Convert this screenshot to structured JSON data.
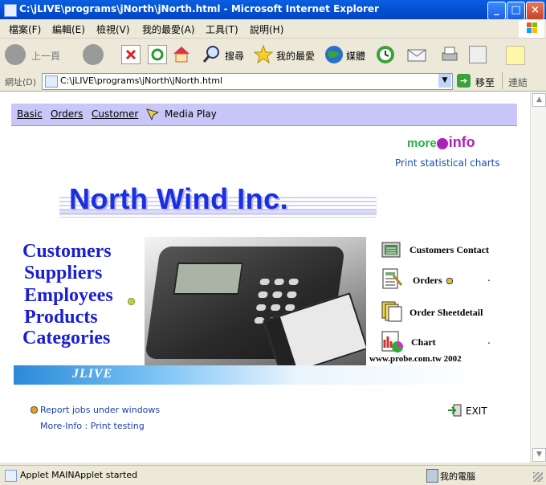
{
  "window": {
    "title": "C:\\jLIVE\\programs\\jNorth\\jNorth.html - Microsoft Internet Explorer"
  },
  "menu": [
    "檔案(F)",
    "編輯(E)",
    "檢視(V)",
    "我的最愛(A)",
    "工具(T)",
    "說明(H)"
  ],
  "toolbar": {
    "back": "上一頁",
    "search": "搜尋",
    "favorites": "我的最愛",
    "media": "媒體"
  },
  "address": {
    "label": "網址(D)",
    "url": "C:\\jLIVE\\programs\\jNorth\\jNorth.html",
    "go": "移至",
    "links": "連結"
  },
  "nav": {
    "basic": "Basic",
    "orders": "Orders",
    "customer": "Customer",
    "media_play": "Media Play"
  },
  "more_info": {
    "more": "more",
    "info": "info",
    "print_charts": "Print statistical charts"
  },
  "logo": "North Wind Inc.",
  "left_links": [
    "Customers",
    "Suppliers",
    "Employees",
    "Products",
    "Categories"
  ],
  "right_links": {
    "customers_contact": "Customers Contact",
    "orders": "Orders",
    "order_sheetdetail": "Order Sheetdetail",
    "chart": "Chart"
  },
  "banner": "JLIVE",
  "credit": "www.probe.com.tw  2002",
  "bottom": {
    "report": "Report jobs under windows",
    "print_testing": "More-Info : Print testing",
    "exit": "EXIT"
  },
  "status": {
    "text": "Applet MAINApplet started",
    "zone": "我的電腦"
  },
  "colors": {
    "accent_blue": "#1a20d0",
    "nav_bg": "#c9c7f7",
    "info_purple": "#b01fb8",
    "more_green": "#25b04a"
  }
}
